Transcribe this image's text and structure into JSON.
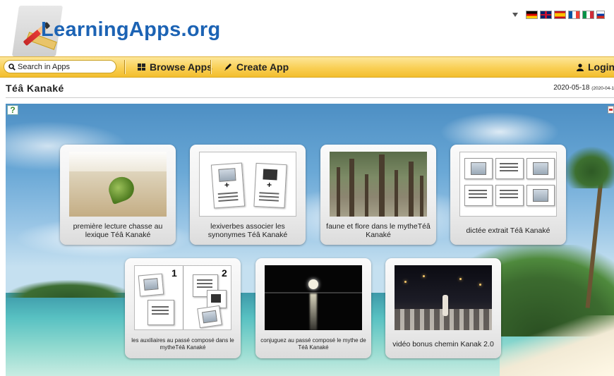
{
  "header": {
    "logo_text": "LearningApps.org",
    "languages": [
      {
        "code": "de",
        "icon": "flag-de-icon"
      },
      {
        "code": "gb",
        "icon": "flag-gb-icon"
      },
      {
        "code": "es",
        "icon": "flag-es-icon"
      },
      {
        "code": "fr",
        "icon": "flag-fr-icon"
      },
      {
        "code": "it",
        "icon": "flag-it-icon"
      },
      {
        "code": "ru",
        "icon": "flag-ru-icon"
      }
    ]
  },
  "nav": {
    "search_placeholder": "Search in Apps",
    "browse_label": "Browse Apps",
    "create_label": "Create App",
    "login_label": "Login"
  },
  "page": {
    "title": "Téâ Kanaké",
    "date": "2020-05-18",
    "date_small": "(2020-04-1"
  },
  "tiles": [
    {
      "label": "première lecture chasse au lexique Téâ Kanaké"
    },
    {
      "label": "lexiverbes associer les synonymes Téâ Kanaké"
    },
    {
      "label": "faune et flore dans le mytheTéâ Kanaké"
    },
    {
      "label": "dictée extrait Téâ Kanaké"
    },
    {
      "label": "les auxiliaires au passé composé dans le mytheTéâ Kanaké",
      "num1": "1",
      "num2": "2"
    },
    {
      "label": "conjuguez au passé composé le mythe de Téâ Kanaké"
    },
    {
      "label": "vidéo bonus chemin Kanak 2.0"
    }
  ],
  "colors": {
    "logo_blue": "#1c63b4",
    "nav_yellow": "#f9cf55",
    "help_green": "#3b8a2f"
  }
}
